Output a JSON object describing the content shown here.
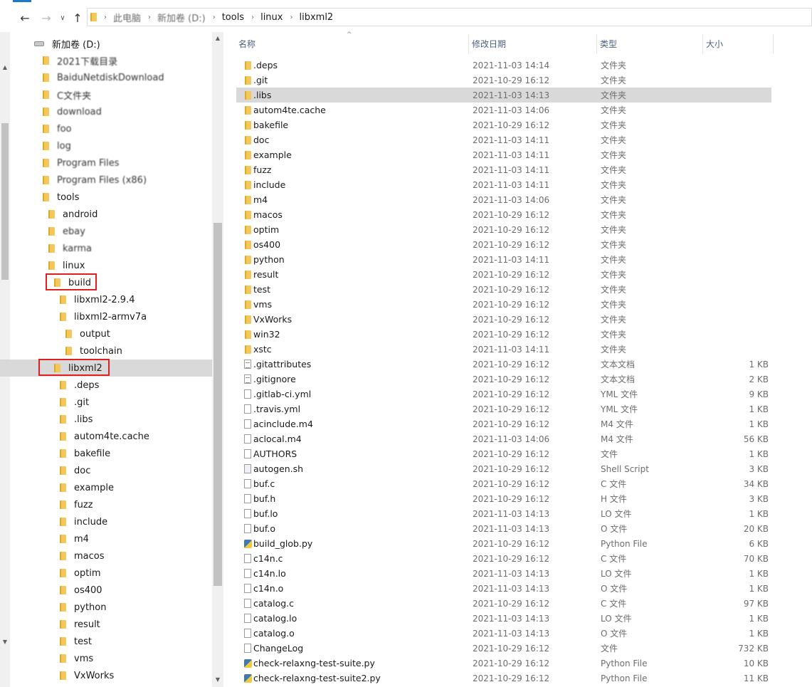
{
  "breadcrumb": [
    "此电脑",
    "新加卷 (D:)",
    "tools",
    "linux",
    "libxml2"
  ],
  "columns": {
    "name": "名称",
    "modified": "修改日期",
    "type": "类型",
    "size": "大小"
  },
  "tree": [
    {
      "label": "新加卷 (D:)",
      "icon": "drive",
      "blur": false
    },
    {
      "label": "2021下载目录",
      "icon": "folder",
      "blur": true
    },
    {
      "label": "BaiduNetdiskDownload",
      "icon": "folder",
      "blur": true
    },
    {
      "label": "C文件夹",
      "icon": "folder",
      "blur": true
    },
    {
      "label": "download",
      "icon": "folder",
      "blur": true
    },
    {
      "label": "foo",
      "icon": "folder",
      "blur": true
    },
    {
      "label": "log",
      "icon": "folder",
      "blur": true
    },
    {
      "label": "Program Files",
      "icon": "folder",
      "blur": true
    },
    {
      "label": "Program Files (x86)",
      "icon": "folder",
      "blur": true
    },
    {
      "label": "tools",
      "icon": "folder",
      "blur": false
    },
    {
      "label": "android",
      "icon": "folder",
      "blur": false
    },
    {
      "label": "ebay",
      "icon": "folder",
      "blur": true
    },
    {
      "label": "karma",
      "icon": "folder",
      "blur": true
    },
    {
      "label": "linux",
      "icon": "folder",
      "blur": false
    },
    {
      "label": "build",
      "icon": "folder",
      "blur": false
    },
    {
      "label": "libxml2-2.9.4",
      "icon": "folder",
      "blur": false
    },
    {
      "label": "libxml2-armv7a",
      "icon": "folder",
      "blur": false
    },
    {
      "label": "output",
      "icon": "folder",
      "blur": false
    },
    {
      "label": "toolchain",
      "icon": "folder",
      "blur": false
    },
    {
      "label": "libxml2",
      "icon": "folder",
      "blur": false
    },
    {
      "label": ".deps",
      "icon": "folder",
      "blur": false
    },
    {
      "label": ".git",
      "icon": "folder",
      "blur": false
    },
    {
      "label": ".libs",
      "icon": "folder",
      "blur": false
    },
    {
      "label": "autom4te.cache",
      "icon": "folder",
      "blur": false
    },
    {
      "label": "bakefile",
      "icon": "folder",
      "blur": false
    },
    {
      "label": "doc",
      "icon": "folder",
      "blur": false
    },
    {
      "label": "example",
      "icon": "folder",
      "blur": false
    },
    {
      "label": "fuzz",
      "icon": "folder",
      "blur": false
    },
    {
      "label": "include",
      "icon": "folder",
      "blur": false
    },
    {
      "label": "m4",
      "icon": "folder",
      "blur": false
    },
    {
      "label": "macos",
      "icon": "folder",
      "blur": false
    },
    {
      "label": "optim",
      "icon": "folder",
      "blur": false
    },
    {
      "label": "os400",
      "icon": "folder",
      "blur": false
    },
    {
      "label": "python",
      "icon": "folder",
      "blur": false
    },
    {
      "label": "result",
      "icon": "folder",
      "blur": false
    },
    {
      "label": "test",
      "icon": "folder",
      "blur": false
    },
    {
      "label": "vms",
      "icon": "folder",
      "blur": false
    },
    {
      "label": "VxWorks",
      "icon": "folder",
      "blur": false
    }
  ],
  "tree_selected": "libxml2",
  "tree_highlighted": [
    "build",
    "libxml2"
  ],
  "files": [
    {
      "name": ".deps",
      "date": "2021-11-03 14:14",
      "type": "文件夹",
      "size": "",
      "icon": "folder"
    },
    {
      "name": ".git",
      "date": "2021-10-29 16:12",
      "type": "文件夹",
      "size": "",
      "icon": "folder"
    },
    {
      "name": ".libs",
      "date": "2021-11-03 14:13",
      "type": "文件夹",
      "size": "",
      "icon": "folder"
    },
    {
      "name": "autom4te.cache",
      "date": "2021-11-03 14:06",
      "type": "文件夹",
      "size": "",
      "icon": "folder"
    },
    {
      "name": "bakefile",
      "date": "2021-10-29 16:12",
      "type": "文件夹",
      "size": "",
      "icon": "folder"
    },
    {
      "name": "doc",
      "date": "2021-11-03 14:11",
      "type": "文件夹",
      "size": "",
      "icon": "folder"
    },
    {
      "name": "example",
      "date": "2021-11-03 14:11",
      "type": "文件夹",
      "size": "",
      "icon": "folder"
    },
    {
      "name": "fuzz",
      "date": "2021-11-03 14:11",
      "type": "文件夹",
      "size": "",
      "icon": "folder"
    },
    {
      "name": "include",
      "date": "2021-11-03 14:11",
      "type": "文件夹",
      "size": "",
      "icon": "folder"
    },
    {
      "name": "m4",
      "date": "2021-11-03 14:06",
      "type": "文件夹",
      "size": "",
      "icon": "folder"
    },
    {
      "name": "macos",
      "date": "2021-10-29 16:12",
      "type": "文件夹",
      "size": "",
      "icon": "folder"
    },
    {
      "name": "optim",
      "date": "2021-10-29 16:12",
      "type": "文件夹",
      "size": "",
      "icon": "folder"
    },
    {
      "name": "os400",
      "date": "2021-10-29 16:12",
      "type": "文件夹",
      "size": "",
      "icon": "folder"
    },
    {
      "name": "python",
      "date": "2021-11-03 14:11",
      "type": "文件夹",
      "size": "",
      "icon": "folder"
    },
    {
      "name": "result",
      "date": "2021-10-29 16:12",
      "type": "文件夹",
      "size": "",
      "icon": "folder"
    },
    {
      "name": "test",
      "date": "2021-10-29 16:12",
      "type": "文件夹",
      "size": "",
      "icon": "folder"
    },
    {
      "name": "vms",
      "date": "2021-10-29 16:12",
      "type": "文件夹",
      "size": "",
      "icon": "folder"
    },
    {
      "name": "VxWorks",
      "date": "2021-10-29 16:12",
      "type": "文件夹",
      "size": "",
      "icon": "folder"
    },
    {
      "name": "win32",
      "date": "2021-10-29 16:12",
      "type": "文件夹",
      "size": "",
      "icon": "folder"
    },
    {
      "name": "xstc",
      "date": "2021-11-03 14:11",
      "type": "文件夹",
      "size": "",
      "icon": "folder"
    },
    {
      "name": ".gitattributes",
      "date": "2021-10-29 16:12",
      "type": "文本文档",
      "size": "1 KB",
      "icon": "text"
    },
    {
      "name": ".gitignore",
      "date": "2021-10-29 16:12",
      "type": "文本文档",
      "size": "2 KB",
      "icon": "text"
    },
    {
      "name": ".gitlab-ci.yml",
      "date": "2021-10-29 16:12",
      "type": "YML 文件",
      "size": "9 KB",
      "icon": "file"
    },
    {
      "name": ".travis.yml",
      "date": "2021-10-29 16:12",
      "type": "YML 文件",
      "size": "1 KB",
      "icon": "file"
    },
    {
      "name": "acinclude.m4",
      "date": "2021-10-29 16:12",
      "type": "M4 文件",
      "size": "1 KB",
      "icon": "file"
    },
    {
      "name": "aclocal.m4",
      "date": "2021-11-03 14:06",
      "type": "M4 文件",
      "size": "56 KB",
      "icon": "file"
    },
    {
      "name": "AUTHORS",
      "date": "2021-10-29 16:12",
      "type": "文件",
      "size": "1 KB",
      "icon": "file"
    },
    {
      "name": "autogen.sh",
      "date": "2021-10-29 16:12",
      "type": "Shell Script",
      "size": "3 KB",
      "icon": "script"
    },
    {
      "name": "buf.c",
      "date": "2021-10-29 16:12",
      "type": "C 文件",
      "size": "34 KB",
      "icon": "file"
    },
    {
      "name": "buf.h",
      "date": "2021-10-29 16:12",
      "type": "H 文件",
      "size": "3 KB",
      "icon": "file"
    },
    {
      "name": "buf.lo",
      "date": "2021-11-03 14:13",
      "type": "LO 文件",
      "size": "1 KB",
      "icon": "file"
    },
    {
      "name": "buf.o",
      "date": "2021-11-03 14:13",
      "type": "O 文件",
      "size": "20 KB",
      "icon": "file"
    },
    {
      "name": "build_glob.py",
      "date": "2021-10-29 16:12",
      "type": "Python File",
      "size": "6 KB",
      "icon": "python"
    },
    {
      "name": "c14n.c",
      "date": "2021-10-29 16:12",
      "type": "C 文件",
      "size": "70 KB",
      "icon": "file"
    },
    {
      "name": "c14n.lo",
      "date": "2021-11-03 14:13",
      "type": "LO 文件",
      "size": "1 KB",
      "icon": "file"
    },
    {
      "name": "c14n.o",
      "date": "2021-11-03 14:13",
      "type": "O 文件",
      "size": "1 KB",
      "icon": "file"
    },
    {
      "name": "catalog.c",
      "date": "2021-10-29 16:12",
      "type": "C 文件",
      "size": "97 KB",
      "icon": "file"
    },
    {
      "name": "catalog.lo",
      "date": "2021-11-03 14:13",
      "type": "LO 文件",
      "size": "1 KB",
      "icon": "file"
    },
    {
      "name": "catalog.o",
      "date": "2021-11-03 14:13",
      "type": "O 文件",
      "size": "1 KB",
      "icon": "file"
    },
    {
      "name": "ChangeLog",
      "date": "2021-10-29 16:12",
      "type": "文件",
      "size": "732 KB",
      "icon": "file"
    },
    {
      "name": "check-relaxng-test-suite.py",
      "date": "2021-10-29 16:12",
      "type": "Python File",
      "size": "10 KB",
      "icon": "python"
    },
    {
      "name": "check-relaxng-test-suite2.py",
      "date": "2021-10-29 16:12",
      "type": "Python File",
      "size": "11 KB",
      "icon": "python"
    }
  ],
  "selected_file": ".libs",
  "colors": {
    "selection": "#d9d9d9",
    "highlight_box": "#e02020",
    "folder": "#f2c75c",
    "header_text": "#4d6082"
  }
}
